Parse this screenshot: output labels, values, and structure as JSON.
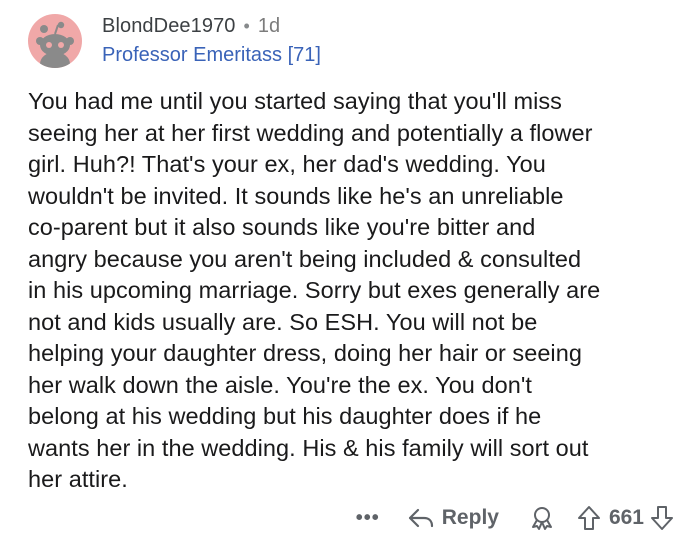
{
  "comment": {
    "username": "BlondDee1970",
    "separator": "•",
    "age": "1d",
    "flair": "Professor Emeritass [71]",
    "body": "You had me until you started saying that you'll miss\nseeing her at her first wedding and potentially a flower\ngirl. Huh?! That's your ex, her dad's wedding. You\nwouldn't be invited. It sounds like he's an unreliable\nco-parent but it also sounds like you're bitter and\nangry because you aren't being included & consulted\nin his upcoming marriage. Sorry but exes generally are\nnot and kids usually are. So ESH. You will not be\nhelping your daughter dress, doing her hair or seeing\nher walk down the aisle. You're the ex. You don't\nbelong at his wedding but his daughter does if he\nwants her in the wedding. His & his family will sort out\nher attire."
  },
  "actions": {
    "more": "•••",
    "reply_label": "Reply",
    "score": "661"
  },
  "icons": {
    "avatar": "reddit-snoo-avatar",
    "reply": "reply-arrow-icon",
    "award": "award-icon",
    "upvote": "upvote-arrow-icon",
    "downvote": "downvote-arrow-icon"
  },
  "colors": {
    "avatar_bg": "#f0a8a8",
    "flair_text": "#3a63b8",
    "muted": "#5f6368"
  }
}
